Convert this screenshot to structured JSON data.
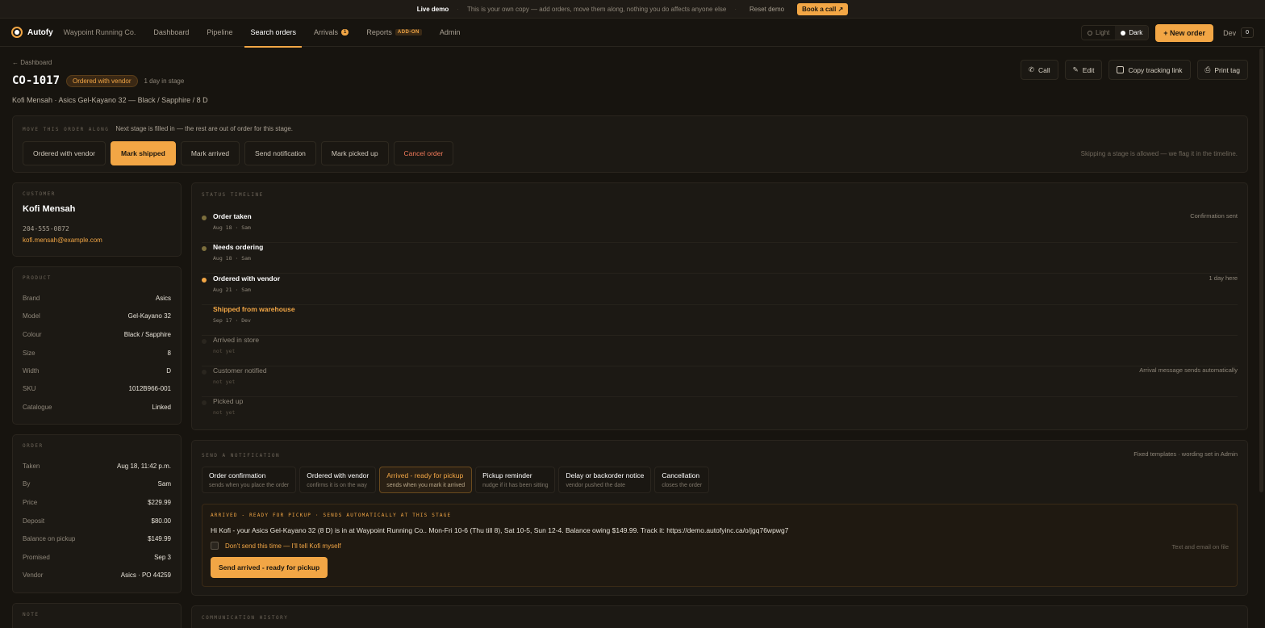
{
  "banner": {
    "live": "Live demo",
    "message": "This is your own copy — add orders, move them along, nothing you do affects anyone else",
    "reset": "Reset demo",
    "book": "Book a call"
  },
  "nav": {
    "brand": "Autofy",
    "shop": "Waypoint Running Co.",
    "items": [
      "Dashboard",
      "Pipeline",
      "Search orders",
      "Arrivals",
      "Reports",
      "Admin"
    ],
    "arrivals_badge": "1",
    "reports_badge": "ADD-ON",
    "theme_light": "Light",
    "theme_dark": "Dark",
    "new_order": "+ New order",
    "dev": "Dev",
    "dev_badge": "0"
  },
  "header": {
    "crumb": "← Dashboard",
    "order_id": "CO-1017",
    "status": "Ordered with vendor",
    "stage_age": "1 day in stage",
    "subtitle": "Kofi Mensah · Asics Gel-Kayano 32 — Black / Sapphire / 8 D",
    "actions": [
      "Call",
      "Edit",
      "Copy tracking link",
      "Print tag"
    ]
  },
  "move": {
    "caption": "MOVE THIS ORDER ALONG",
    "hint": "Next stage is filled in — the rest are out of order for this stage.",
    "buttons": [
      "Ordered with vendor",
      "Mark shipped",
      "Mark arrived",
      "Send notification",
      "Mark picked up",
      "Cancel order"
    ],
    "skip_note": "Skipping a stage is allowed — we flag it in the timeline."
  },
  "customer": {
    "caption": "CUSTOMER",
    "name": "Kofi Mensah",
    "phone": "204-555-0872",
    "email": "kofi.mensah@example.com"
  },
  "product": {
    "caption": "PRODUCT",
    "rows": [
      {
        "k": "Brand",
        "v": "Asics"
      },
      {
        "k": "Model",
        "v": "Gel-Kayano 32"
      },
      {
        "k": "Colour",
        "v": "Black / Sapphire"
      },
      {
        "k": "Size",
        "v": "8"
      },
      {
        "k": "Width",
        "v": "D"
      },
      {
        "k": "SKU",
        "v": "1012B966-001"
      },
      {
        "k": "Catalogue",
        "v": "Linked"
      }
    ]
  },
  "order": {
    "caption": "ORDER",
    "rows": [
      {
        "k": "Taken",
        "v": "Aug 18, 11:42 p.m."
      },
      {
        "k": "By",
        "v": "Sam"
      },
      {
        "k": "Price",
        "v": "$229.99"
      },
      {
        "k": "Deposit",
        "v": "$80.00"
      },
      {
        "k": "Balance on pickup",
        "v": "$149.99"
      },
      {
        "k": "Promised",
        "v": "Sep 3"
      },
      {
        "k": "Vendor",
        "v": "Asics · PO 44259"
      }
    ]
  },
  "note": {
    "caption": "NOTE"
  },
  "timeline": {
    "caption": "STATUS TIMELINE",
    "rows": [
      {
        "label": "Order taken",
        "meta": "Aug 18 · Sam",
        "note": "Confirmation sent"
      },
      {
        "label": "Needs ordering",
        "meta": "Aug 18 · Sam",
        "note": ""
      },
      {
        "label": "Ordered with vendor",
        "meta": "Aug 21 · Sam",
        "note": "1 day here"
      },
      {
        "label": "Shipped from warehouse",
        "meta": "Sep 17 · Dev",
        "note": ""
      },
      {
        "label": "Arrived in store",
        "meta": "not yet",
        "note": ""
      },
      {
        "label": "Customer notified",
        "meta": "not yet",
        "note": "Arrival message sends automatically"
      },
      {
        "label": "Picked up",
        "meta": "not yet",
        "note": ""
      }
    ]
  },
  "notify": {
    "caption": "SEND A NOTIFICATION",
    "note": "Fixed templates · wording set in Admin",
    "templates": [
      {
        "title": "Order confirmation",
        "sub": "sends when you place the order"
      },
      {
        "title": "Ordered with vendor",
        "sub": "confirms it is on the way"
      },
      {
        "title": "Arrived - ready for pickup",
        "sub": "sends when you mark it arrived"
      },
      {
        "title": "Pickup reminder",
        "sub": "nudge if it has been sitting"
      },
      {
        "title": "Delay or backorder notice",
        "sub": "vendor pushed the date"
      },
      {
        "title": "Cancellation",
        "sub": "closes the order"
      }
    ],
    "preview_caption": "ARRIVED - READY FOR PICKUP · SENDS AUTOMATICALLY AT THIS STAGE",
    "preview_msg": "Hi Kofi - your Asics Gel-Kayano 32 (8 D) is in at Waypoint Running Co.. Mon-Fri 10-6 (Thu till 8), Sat 10-5, Sun 12-4. Balance owing $149.99. Track it: https://demo.autofyinc.ca/o/jgq76wpwg7",
    "skip_label": "Don't send this time — I'll tell Kofi myself",
    "channel": "Text and email on file",
    "send": "Send arrived - ready for pickup"
  },
  "history": {
    "caption": "COMMUNICATION HISTORY"
  },
  "colors": {
    "accent": "#f2a645",
    "bg": "#17140f",
    "panel": "#1c1914",
    "danger": "#f27a5a"
  }
}
